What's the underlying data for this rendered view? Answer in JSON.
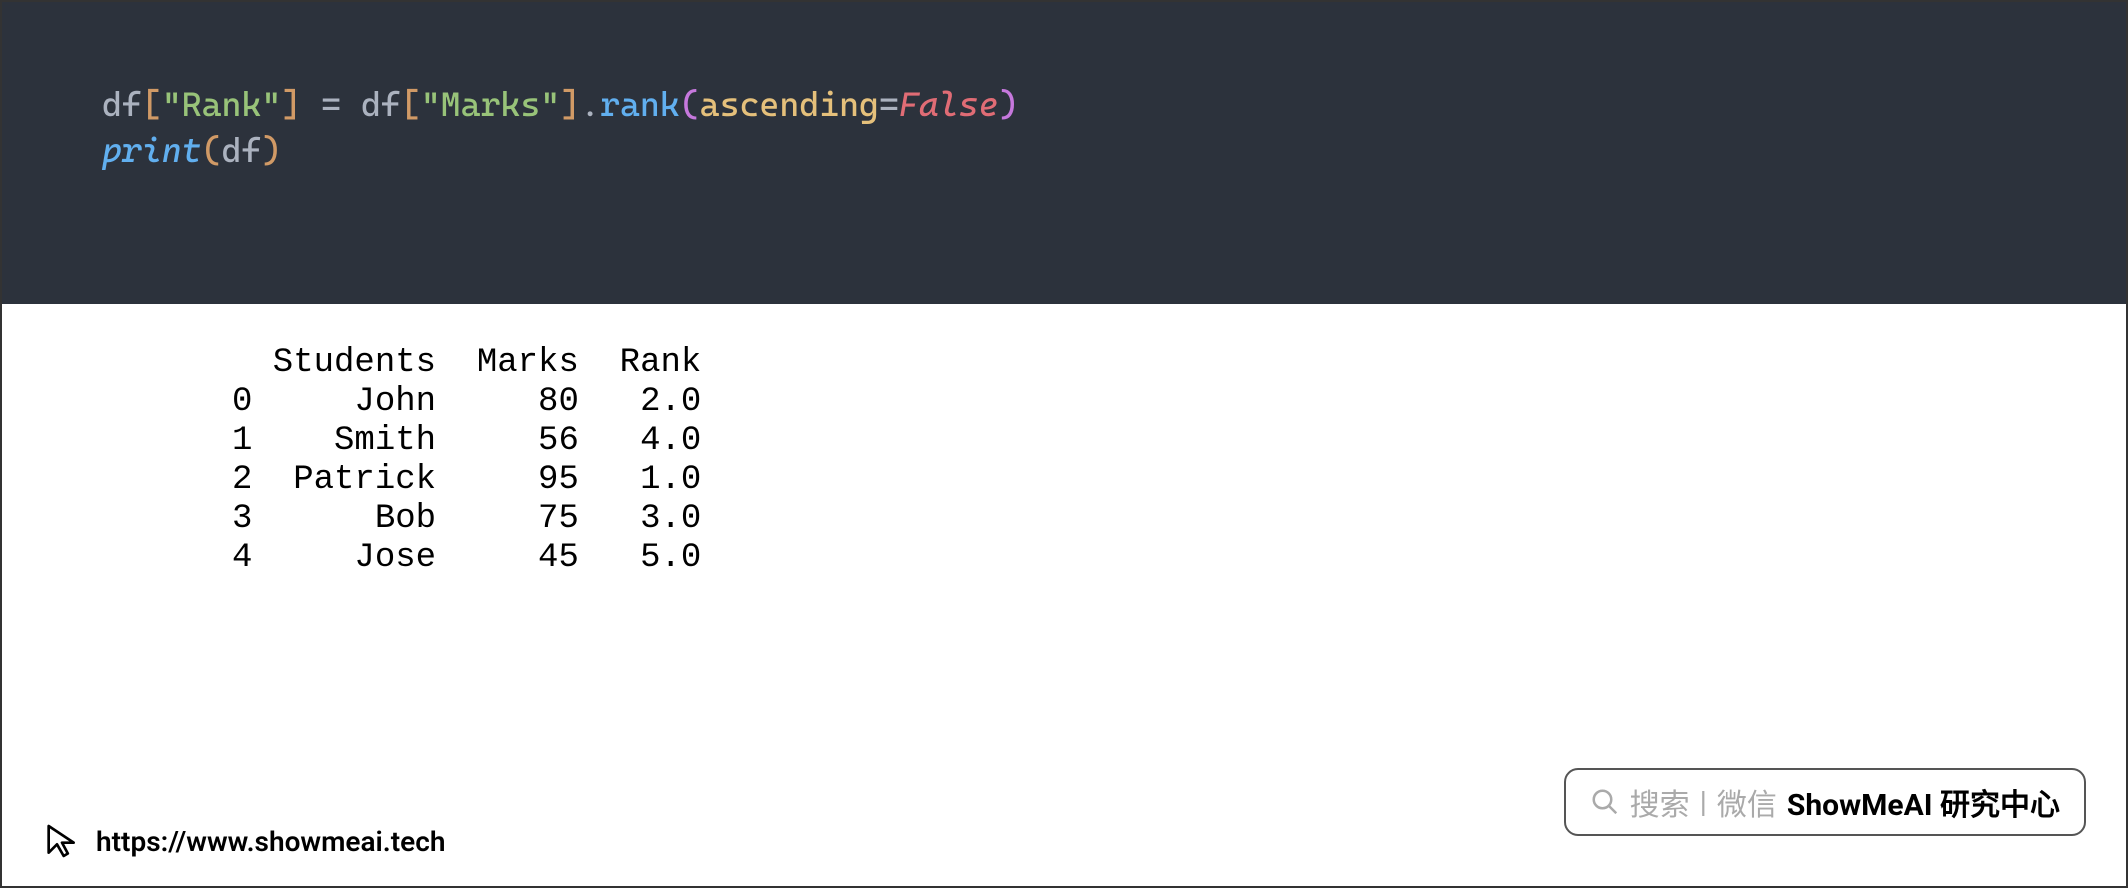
{
  "code": {
    "line1": {
      "t1": "df",
      "t2": "[",
      "t3": "\"Rank\"",
      "t4": "]",
      "t5": " ",
      "t6": "=",
      "t7": " df",
      "t8": "[",
      "t9": "\"Marks\"",
      "t10": "]",
      "t11": ".",
      "t12": "rank",
      "t13": "(",
      "t14": "ascending",
      "t15": "=",
      "t16": "False",
      "t17": ")"
    },
    "line2": {
      "t1": "print",
      "t2": "(",
      "t3": "df",
      "t4": ")"
    }
  },
  "output_text": "  Students  Marks  Rank\n0     John     80   2.0\n1    Smith     56   4.0\n2  Patrick     95   1.0\n3      Bob     75   3.0\n4     Jose     45   5.0",
  "chart_data": {
    "type": "table",
    "columns": [
      "",
      "Students",
      "Marks",
      "Rank"
    ],
    "rows": [
      [
        0,
        "John",
        80,
        2.0
      ],
      [
        1,
        "Smith",
        56,
        4.0
      ],
      [
        2,
        "Patrick",
        95,
        1.0
      ],
      [
        3,
        "Bob",
        75,
        3.0
      ],
      [
        4,
        "Jose",
        45,
        5.0
      ]
    ]
  },
  "footer": {
    "url": "https://www.showmeai.tech"
  },
  "badge": {
    "search_label": "搜索",
    "separator": "|",
    "wechat_label": "微信",
    "brand": "ShowMeAI 研究中心"
  }
}
